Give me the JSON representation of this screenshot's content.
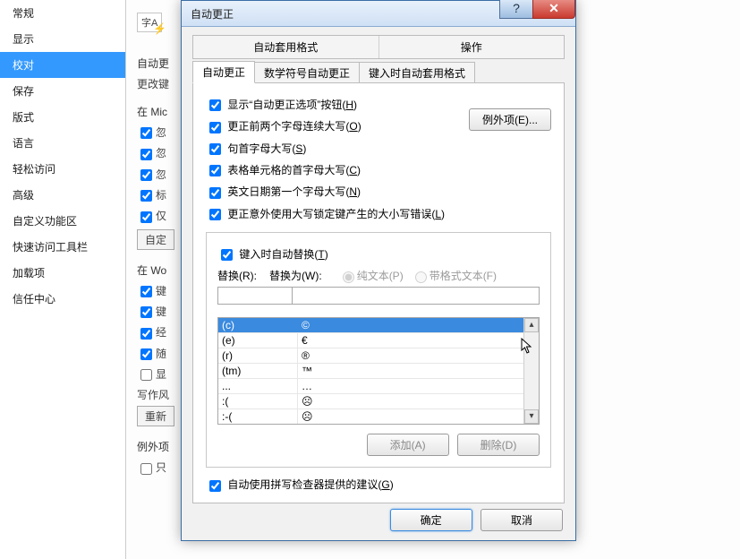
{
  "nav": {
    "items": [
      "常规",
      "显示",
      "校对",
      "保存",
      "版式",
      "语言",
      "轻松访问",
      "高级",
      "自定义功能区",
      "快速访问工具栏",
      "加载项",
      "信任中心"
    ],
    "selected_index": 2
  },
  "bg_panel": {
    "icon_text": "字A",
    "row1": "自动更",
    "row2": "更改键",
    "section1": "在 Mic",
    "checks1": [
      "忽",
      "忽",
      "忽",
      "标",
      "仅"
    ],
    "autocorrect_btn": "自定",
    "section2": "在 Wo",
    "checks2": [
      "键",
      "键",
      "经",
      "随",
      "显"
    ],
    "writing_label": "写作风",
    "rewrite_btn": "重新",
    "section3": "例外项",
    "check3": "只"
  },
  "modal": {
    "title": "自动更正",
    "win_help": "?",
    "win_close": "✕",
    "top_tabs": [
      "自动套用格式",
      "操作"
    ],
    "sub_tabs": [
      "自动更正",
      "数学符号自动更正",
      "键入时自动套用格式"
    ],
    "active_subtab": 0,
    "check_show_btn": {
      "pre": "显示“自动更正选项”按钮(",
      "u": "H",
      "post": ")"
    },
    "check_two_caps": {
      "pre": "更正前两个字母连续大写(",
      "u": "O",
      "post": ")"
    },
    "check_sentence": {
      "pre": "句首字母大写(",
      "u": "S",
      "post": ")"
    },
    "check_tablecell": {
      "pre": "表格单元格的首字母大写(",
      "u": "C",
      "post": ")"
    },
    "check_weekday": {
      "pre": "英文日期第一个字母大写(",
      "u": "N",
      "post": ")"
    },
    "check_capslock": {
      "pre": "更正意外使用大写锁定键产生的大小写错误(",
      "u": "L",
      "post": ")"
    },
    "exceptions_btn": {
      "pre": "例外项(",
      "u": "E",
      "post": ")..."
    },
    "replace_box": {
      "check_replace": {
        "pre": "键入时自动替换(",
        "u": "T",
        "post": ")"
      },
      "replace_label": {
        "pre": "替换(",
        "u": "R",
        "post": "):"
      },
      "with_label": {
        "pre": "替换为(",
        "u": "W",
        "post": "):"
      },
      "radio_plain": "纯文本(P)",
      "radio_formatted": "带格式文本(F)",
      "add_btn": "添加(A)",
      "delete_btn": "删除(D)"
    },
    "subs": [
      {
        "a": "(c)",
        "b": "©"
      },
      {
        "a": "(e)",
        "b": "€"
      },
      {
        "a": "(r)",
        "b": "®"
      },
      {
        "a": "(tm)",
        "b": "™"
      },
      {
        "a": "...",
        "b": "…"
      },
      {
        "a": ":(",
        "b": "☹"
      },
      {
        "a": ":-(",
        "b": "☹"
      }
    ],
    "subs_selected": 0,
    "check_spell_suggest": {
      "pre": "自动使用拼写检查器提供的建议(",
      "u": "G",
      "post": ")"
    },
    "ok_btn": "确定",
    "cancel_btn": "取消"
  }
}
